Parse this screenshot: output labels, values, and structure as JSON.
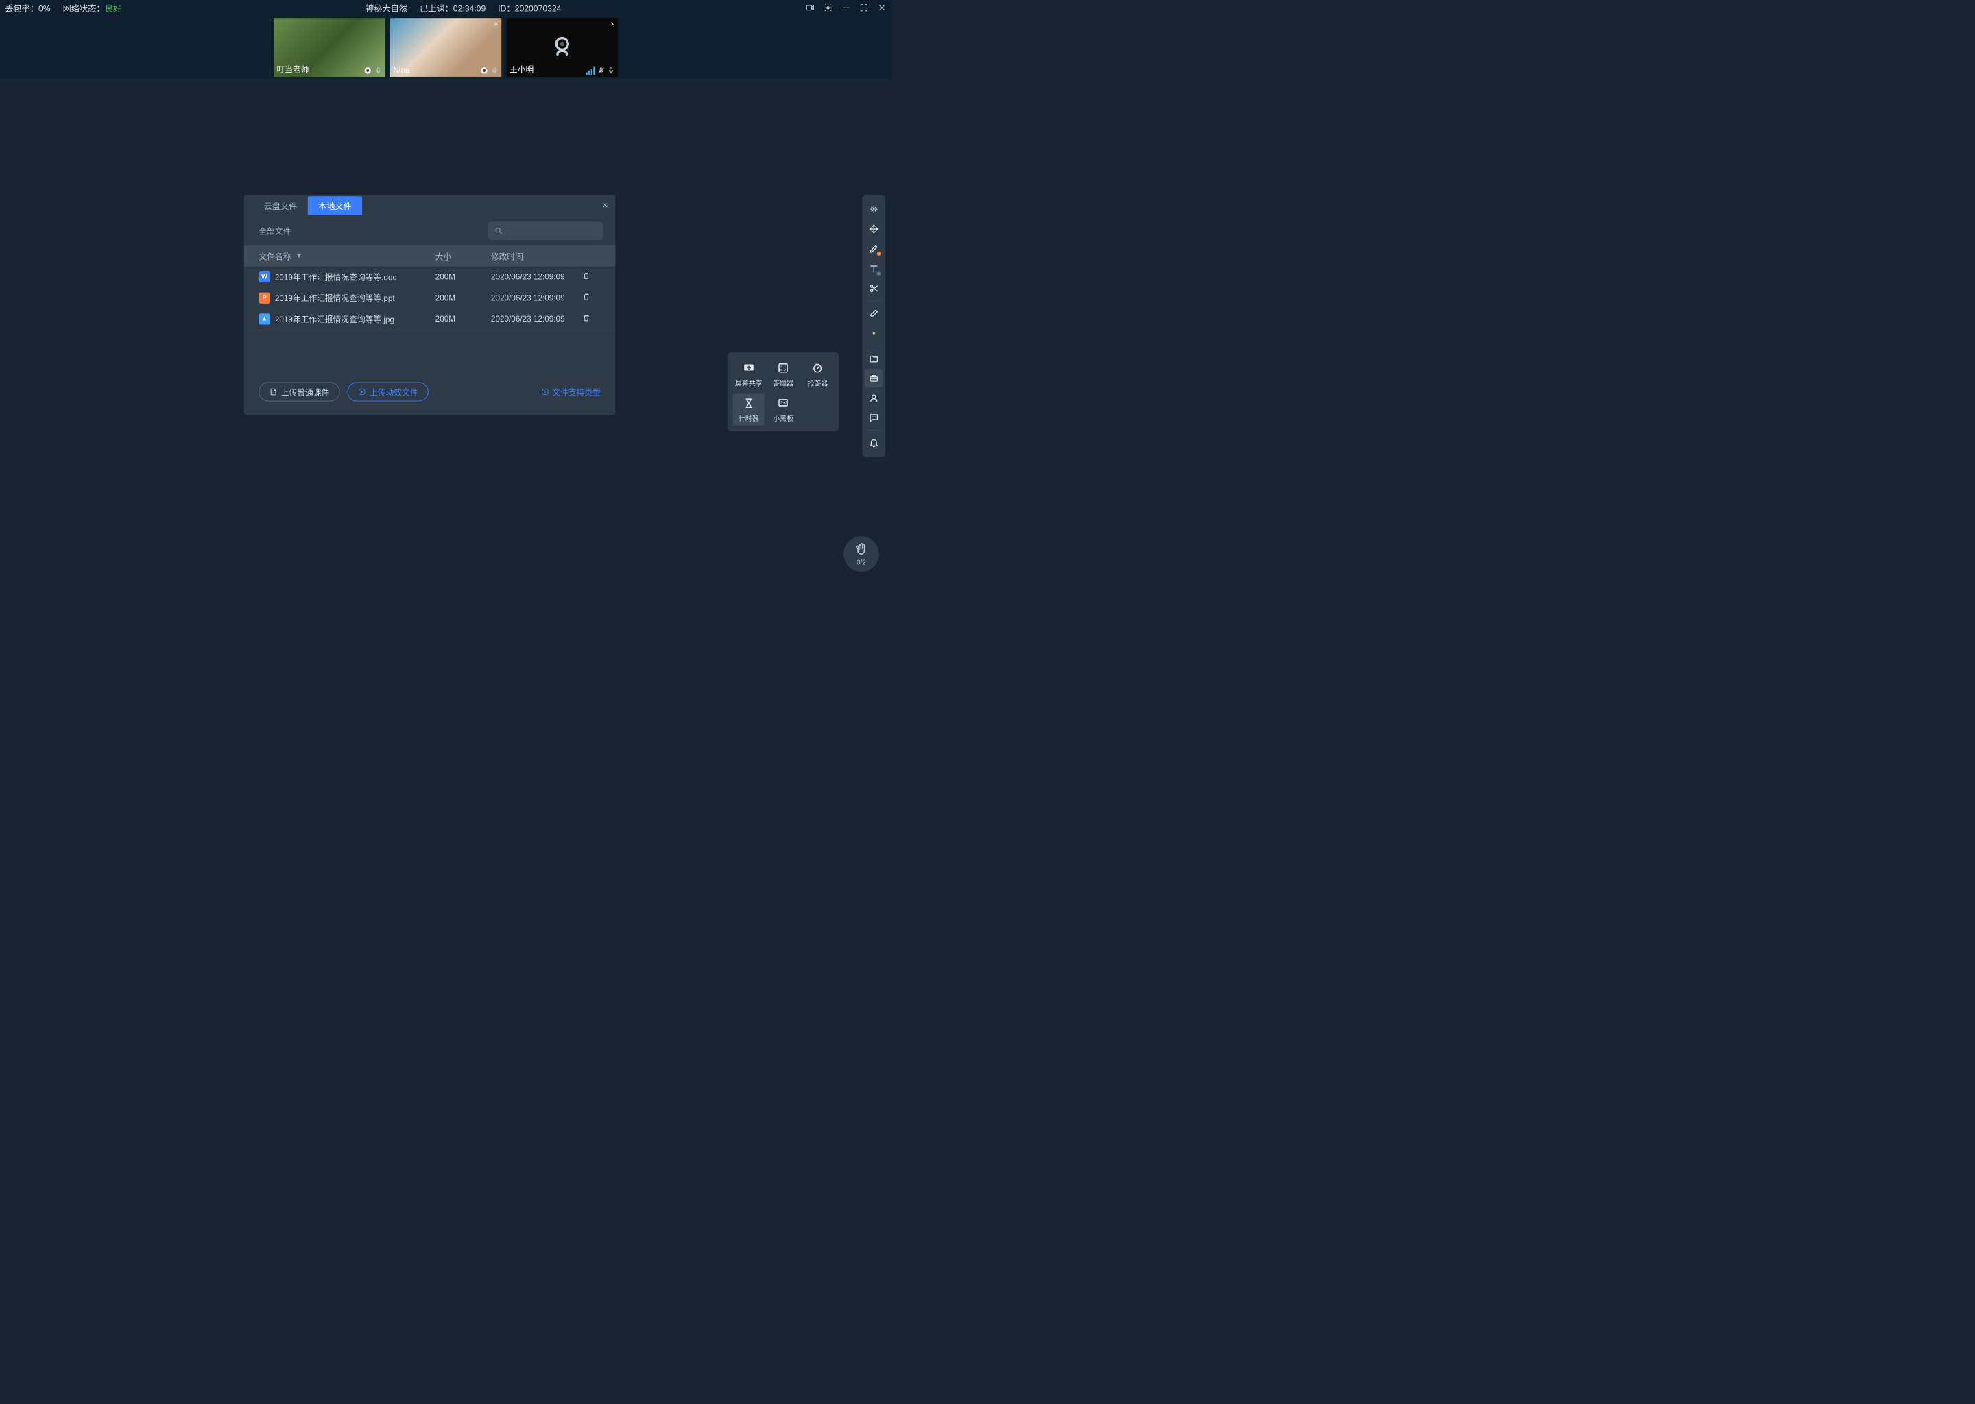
{
  "topbar": {
    "packet_loss_label": "丢包率：",
    "packet_loss_value": "0%",
    "network_label": "网络状态：",
    "network_value": "良好",
    "title": "神秘大自然",
    "elapsed_label": "已上课：",
    "elapsed_value": "02:34:09",
    "id_label": "ID：",
    "id_value": "2020070324"
  },
  "participants": [
    {
      "name": "叮当老师"
    },
    {
      "name": "Nina"
    },
    {
      "name": "王小明"
    }
  ],
  "dialog": {
    "tab_cloud": "云盘文件",
    "tab_local": "本地文件",
    "crumb": "全部文件",
    "col_name": "文件名称",
    "col_size": "大小",
    "col_time": "修改时间",
    "files": [
      {
        "icon": "W",
        "cls": "doc",
        "name": "2019年工作汇报情况查询等等.doc",
        "size": "200M",
        "time": "2020/06/23 12:09:09"
      },
      {
        "icon": "P",
        "cls": "ppt",
        "name": "2019年工作汇报情况查询等等.ppt",
        "size": "200M",
        "time": "2020/06/23 12:09:09"
      },
      {
        "icon": "▲",
        "cls": "img",
        "name": "2019年工作汇报情况查询等等.jpg",
        "size": "200M",
        "time": "2020/06/23 12:09:09"
      }
    ],
    "btn_upload_normal": "上传普通课件",
    "btn_upload_anim": "上传动效文件",
    "support_link": "文件支持类型"
  },
  "tools_popup": {
    "items": [
      {
        "label": "屏幕共享"
      },
      {
        "label": "答题器"
      },
      {
        "label": "抢答器"
      },
      {
        "label": "计时器"
      },
      {
        "label": "小黑板"
      }
    ]
  },
  "hand": {
    "count": "0/2"
  }
}
